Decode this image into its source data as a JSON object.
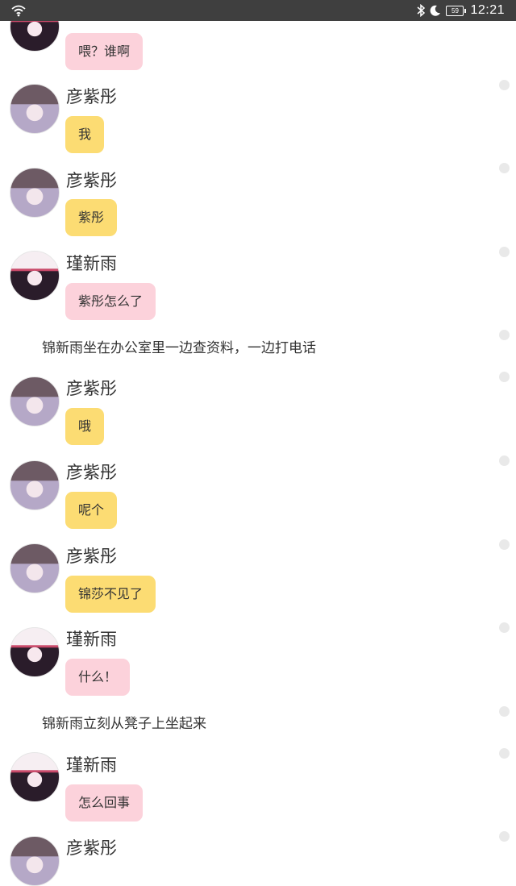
{
  "status_bar": {
    "time": "12:21",
    "battery": "59",
    "icons": [
      "wifi-icon",
      "bluetooth-icon",
      "moon-icon",
      "battery-icon"
    ]
  },
  "colors": {
    "yellow_bubble": "#fcdc73",
    "pink_bubble": "#fcd2db",
    "status_bar": "#3f3f3f"
  },
  "messages": {
    "m0": {
      "text": "喂？谁啊"
    },
    "m1": {
      "sender": "彦紫彤",
      "text": "我"
    },
    "m2": {
      "sender": "彦紫彤",
      "text": "紫彤"
    },
    "m3": {
      "sender": "瑾新雨",
      "text": "紫彤怎么了"
    },
    "n1": {
      "text": "锦新雨坐在办公室里一边查资料，一边打电话"
    },
    "m4": {
      "sender": "彦紫彤",
      "text": "哦"
    },
    "m5": {
      "sender": "彦紫彤",
      "text": "呢个"
    },
    "m6": {
      "sender": "彦紫彤",
      "text": "锦莎不见了"
    },
    "m7": {
      "sender": "瑾新雨",
      "text": "什么！"
    },
    "n2": {
      "text": "锦新雨立刻从凳子上坐起来"
    },
    "m8": {
      "sender": "瑾新雨",
      "text": "怎么回事"
    },
    "m9": {
      "sender": "彦紫彤"
    }
  }
}
